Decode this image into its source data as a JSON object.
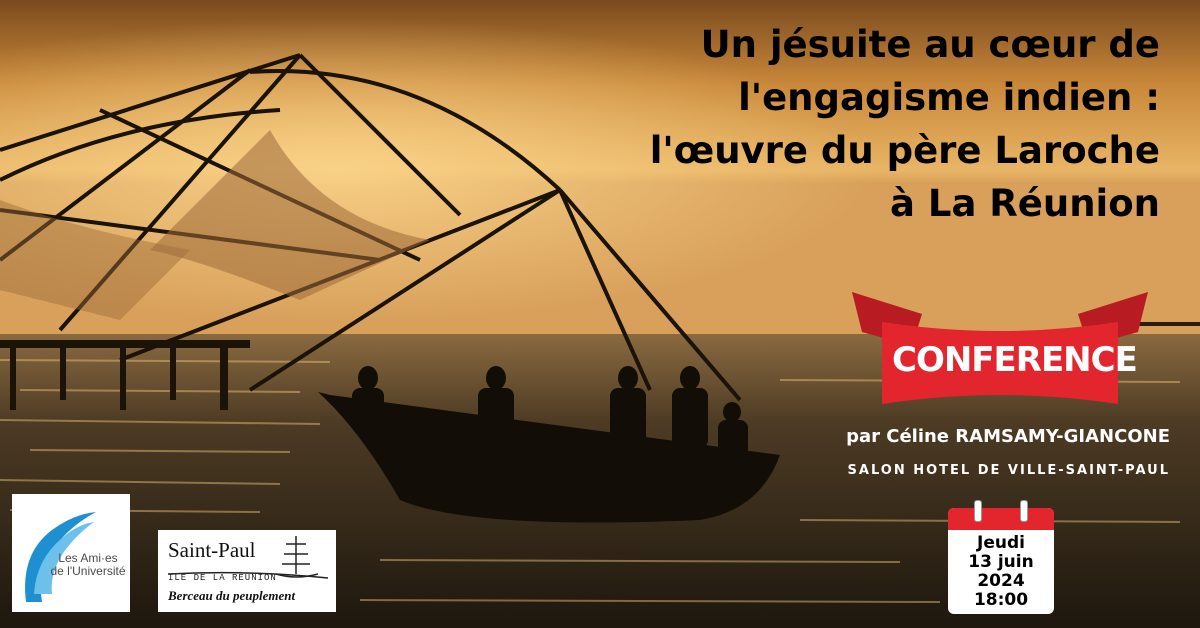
{
  "title": {
    "lines": [
      "Un jésuite au cœur de",
      "l'engagisme indien :",
      "l'œuvre du père Laroche",
      "à La Réunion"
    ]
  },
  "banner": {
    "label": "CONFERENCE",
    "color": "#e3262e"
  },
  "speaker": "par Céline RAMSAMY-GIANCONE",
  "venue": "SALON HOTEL DE VILLE-SAINT-PAUL",
  "calendar": {
    "day": "Jeudi",
    "date": "13 juin",
    "year": "2024",
    "time": "18:00",
    "color": "#e3262e"
  },
  "logos": {
    "amis": {
      "line1": "Les Ami·es",
      "line2": "de l'Université",
      "color": "#1e8fd0"
    },
    "saint_paul": {
      "name": "Saint-Paul",
      "subtitle": "ILE DE LA REUNION",
      "tagline": "Berceau du peuplement"
    }
  },
  "background": {
    "sky_top": "#d79a3c",
    "sky_bottom": "#c88a3a",
    "sea": "#2a2418"
  }
}
